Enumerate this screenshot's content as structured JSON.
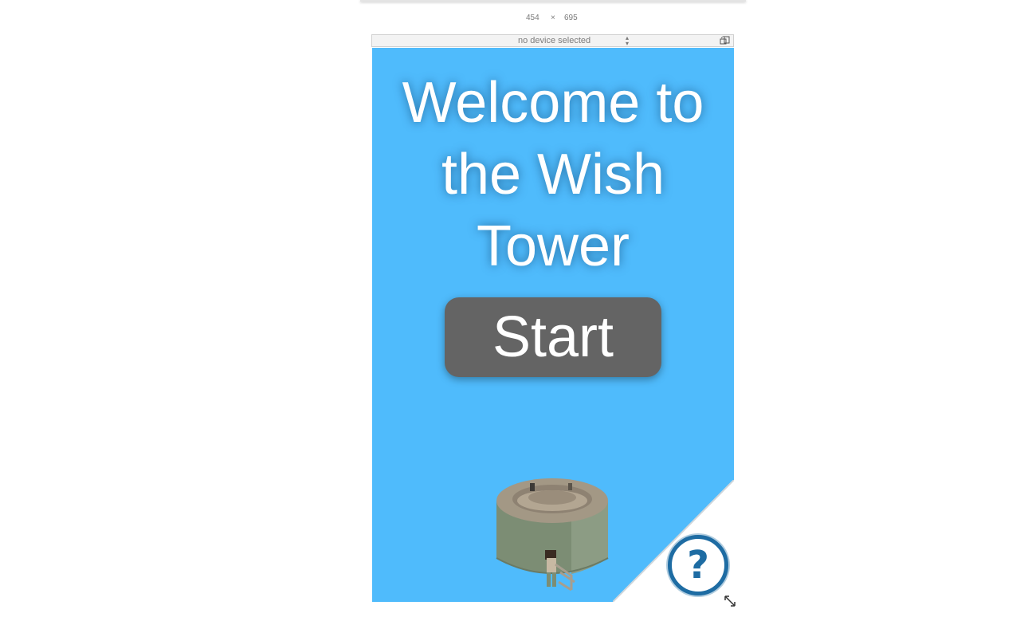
{
  "devtools": {
    "width": "454",
    "times": "×",
    "height": "695",
    "device_select": "no device selected",
    "rotate_icon": "rotate-device-icon",
    "resize_icon": "resize-handle-icon"
  },
  "game": {
    "title_lines": [
      "Welcome to",
      "the Wish",
      "Tower"
    ],
    "start_label": "Start",
    "help_label": "?",
    "colors": {
      "background": "#4fbbfc",
      "button": "#646464",
      "help_ring": "#1e6ca3",
      "tower": "#7a8a72"
    }
  }
}
